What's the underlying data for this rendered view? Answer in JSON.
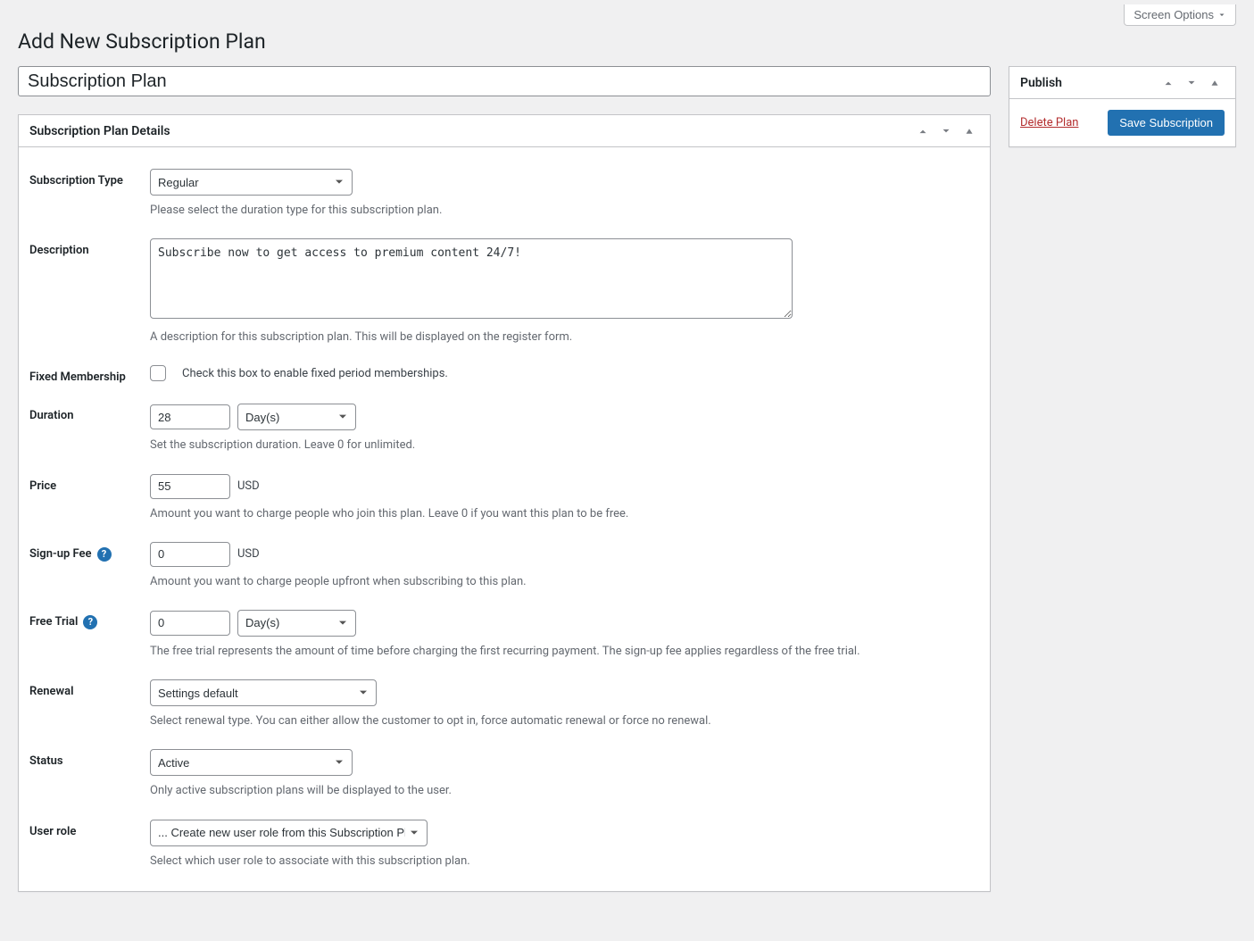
{
  "screen_options_label": "Screen Options",
  "page_title": "Add New Subscription Plan",
  "title_value": "Subscription Plan",
  "publish_panel": {
    "title": "Publish",
    "delete_label": "Delete Plan",
    "save_label": "Save Subscription"
  },
  "details_panel": {
    "title": "Subscription Plan Details"
  },
  "fields": {
    "subscription_type": {
      "label": "Subscription Type",
      "value": "Regular",
      "help": "Please select the duration type for this subscription plan."
    },
    "description": {
      "label": "Description",
      "value": "Subscribe now to get access to premium content 24/7!",
      "help": "A description for this subscription plan. This will be displayed on the register form."
    },
    "fixed_membership": {
      "label": "Fixed Membership",
      "checkbox_label": "Check this box to enable fixed period memberships."
    },
    "duration": {
      "label": "Duration",
      "value": "28",
      "unit": "Day(s)",
      "help": "Set the subscription duration. Leave 0 for unlimited."
    },
    "price": {
      "label": "Price",
      "value": "55",
      "currency": "USD",
      "help": "Amount you want to charge people who join this plan. Leave 0 if you want this plan to be free."
    },
    "signup_fee": {
      "label": "Sign-up Fee",
      "value": "0",
      "currency": "USD",
      "help": "Amount you want to charge people upfront when subscribing to this plan."
    },
    "free_trial": {
      "label": "Free Trial",
      "value": "0",
      "unit": "Day(s)",
      "help": "The free trial represents the amount of time before charging the first recurring payment. The sign-up fee applies regardless of the free trial."
    },
    "renewal": {
      "label": "Renewal",
      "value": "Settings default",
      "help": "Select renewal type. You can either allow the customer to opt in, force automatic renewal or force no renewal."
    },
    "status": {
      "label": "Status",
      "value": "Active",
      "help": "Only active subscription plans will be displayed to the user."
    },
    "user_role": {
      "label": "User role",
      "value": "... Create new user role from this Subscription Plan",
      "help": "Select which user role to associate with this subscription plan."
    }
  }
}
